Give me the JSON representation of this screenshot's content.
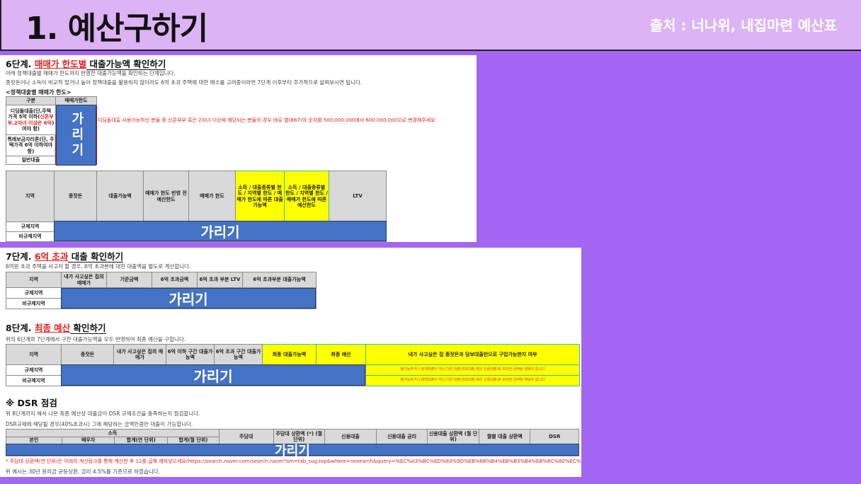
{
  "header": {
    "title": "1. 예산구하기",
    "source": "출처 : 너나위, 내집마련 예산표"
  },
  "step6": {
    "heading_prefix": "6단계. ",
    "heading_red": "매매가 한도별",
    "heading_suffix": " 대출가능액 확인하기",
    "desc1": "아래 정책대출별 매매가 한도까지 반영한 대출가능액을 확인하는 단계입니다.",
    "desc2": "종잣돈이나 소득이 비교적 많거나 높아 정책대출을 활용하지 않더라도 6억 초과 주택에 대한 매수를 고려중이라면 7단계 이후부터 추가적으로 살펴보시면 됩니다.",
    "subheading": "<정책대출별 매매가 한도>",
    "policy_table": {
      "col1": "구분",
      "col2": "매매가한도",
      "row1_a": "디딤돌대출(단,주택",
      "row1_b": "가격 5억 이하(",
      "row1_red": "신혼부부,2자녀 이상은 6억",
      "row1_c": ")여야 함)",
      "row2": "특례보금자리론(단, 주택가격 6억 이하여야 함)",
      "row3": "일반대출"
    },
    "cover_label": "가리기",
    "red_note": "디딤돌대출 사용가능하신 분들 중 신혼부부 혹은 2자녀 이상에 해당되는 분들의 경우 바로 옆(B67)의 숫자를 500,000,000에서 600,000,000으로 변경해주세요",
    "main_headers": [
      "지역",
      "종잣돈",
      "대출가능액",
      "매매가 한도 반영 전 예산한도",
      "매매가 한도",
      "소득 / 대출종류별 한도 / 지역별 한도 / 매매가 한도에 따른 대출가능액",
      "소득 / 대출종류별 한도 / 지역별 한도 / 매매가 한도에 따른 예산한도",
      "LTV"
    ],
    "rows": [
      "규제지역",
      "비규제지역"
    ]
  },
  "step7": {
    "heading_prefix": "7단계. ",
    "heading_red": "6억 초과",
    "heading_suffix": " 대출 확인하기",
    "desc": "6억원 초과 주택을 사고자 할 경우, 6억 초과분에 대한 대출액을 별도로 계산합니다.",
    "headers": [
      "지역",
      "내가 사고싶은 집의 매매가",
      "기준금액",
      "6억 초과금액",
      "6억 초과 부분 LTV",
      "6억 초과부분 대출가능액"
    ],
    "rows": [
      "규제지역",
      "비규제지역"
    ],
    "cover_label": "가리기"
  },
  "step8": {
    "heading_prefix": "8단계. ",
    "heading_red": "최종 예산",
    "heading_suffix": " 확인하기",
    "desc": "위의 6단계와 7단계에서 구한 대출가능액을 모두 반영하여 최종 예산을 구합니다.",
    "headers": [
      "지역",
      "종잣돈",
      "내가 사고싶은 집의 매매가",
      "6억 이하 구간 대출가능액",
      "6억 초과 구간 대출가능액",
      "최종 대출가능액",
      "최종 예산",
      "내가 사고싶은 집 종잣돈과 담보대출만으로 구입가능한지 여부"
    ],
    "rows": [
      "규제지역",
      "비규제지역"
    ],
    "cover_label": "가리기",
    "result1": "불가능하거나 정책대출이 아닌 다른 대출(생초대출 혹은 신용대출)로 모자란 금액을 채워야 합니다",
    "result2": "불가능하거나 정책대출이 아닌 다른 대출(생초대출 혹은 신용대출)로 모자란 금액을 채워야 합니다"
  },
  "dsr": {
    "heading": "※ DSR 점검",
    "desc1": "위 8단계까지 해서 나온 최종 예산상 대출금이 DSR 규제조건을 충족하는지 점검합니다.",
    "desc2": "DSR규제에 해당될 경우(40%초과시) 그에 해당하는 금액만큼만 대출이 가능합니다.",
    "headers_top": [
      "소득",
      "주담대",
      "주담대 상환액 (*) (월 단위)",
      "신용대출",
      "신용대출 금리",
      "신용대출 상환액 (월 단위)",
      "월별 대출 상환액",
      "DSR"
    ],
    "headers_sub": [
      "본인",
      "배우자",
      "합계(연 단위)",
      "합계(월 단위)"
    ],
    "cover_label": "가리기",
    "footnote1": "* 주담대 상환액(연 단위)은 아래의 계산링크를 통해 계산한 후 12를 곱해 채워넣으세요(https://search.naver.com/search.naver?sm=tab_sug.top&where=nexearch&query=%EC%A3%BC%ED%83%9D%EB%8B%B4%EB%B3%B4%EB%8C%80%EC%B6%9C+%EA%B3%84%EC%82%B0%EA%B8%B0)",
    "footnote2": "위 예시는 30년 원리금 균등상환, 금리 4.5%를 기준으로 하였습니다."
  }
}
